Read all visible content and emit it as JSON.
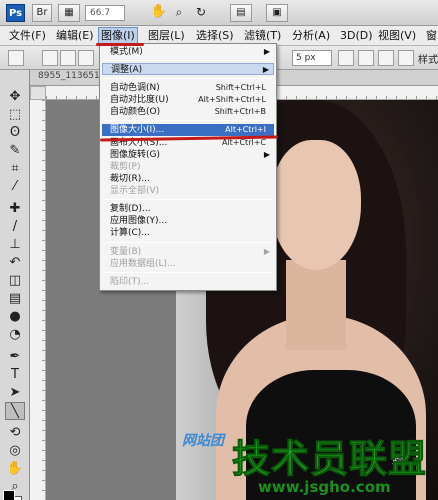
{
  "appbar": {
    "logo": "Ps",
    "zoom": "66.7"
  },
  "menubar": {
    "items": [
      "文件(F)",
      "编辑(E)",
      "图像(I)",
      "图层(L)",
      "选择(S)",
      "滤镜(T)",
      "分析(A)",
      "3D(D)",
      "视图(V)",
      "窗口"
    ]
  },
  "options": {
    "feather": "5 px",
    "style_label": "样式"
  },
  "document": {
    "tab_title": "8955_113651..."
  },
  "dropdown": {
    "items": [
      {
        "label": "模式(M)",
        "shortcut": "",
        "submenu": true,
        "disabled": false
      },
      {
        "label": "调整(A)",
        "shortcut": "",
        "submenu": true,
        "disabled": false
      },
      {
        "label": "自动色调(N)",
        "shortcut": "Shift+Ctrl+L",
        "submenu": false,
        "disabled": false
      },
      {
        "label": "自动对比度(U)",
        "shortcut": "Alt+Shift+Ctrl+L",
        "submenu": false,
        "disabled": false
      },
      {
        "label": "自动颜色(O)",
        "shortcut": "Shift+Ctrl+B",
        "submenu": false,
        "disabled": false
      },
      {
        "label": "图像大小(I)...",
        "shortcut": "Alt+Ctrl+I",
        "submenu": false,
        "disabled": false
      },
      {
        "label": "画布大小(S)...",
        "shortcut": "Alt+Ctrl+C",
        "submenu": false,
        "disabled": false
      },
      {
        "label": "图像旋转(G)",
        "shortcut": "",
        "submenu": true,
        "disabled": false
      },
      {
        "label": "裁剪(P)",
        "shortcut": "",
        "submenu": false,
        "disabled": true
      },
      {
        "label": "裁切(R)...",
        "shortcut": "",
        "submenu": false,
        "disabled": false
      },
      {
        "label": "显示全部(V)",
        "shortcut": "",
        "submenu": false,
        "disabled": true
      },
      {
        "label": "复制(D)...",
        "shortcut": "",
        "submenu": false,
        "disabled": false
      },
      {
        "label": "应用图像(Y)...",
        "shortcut": "",
        "submenu": false,
        "disabled": false
      },
      {
        "label": "计算(C)...",
        "shortcut": "",
        "submenu": false,
        "disabled": false
      },
      {
        "label": "变量(B)",
        "shortcut": "",
        "submenu": true,
        "disabled": true
      },
      {
        "label": "应用数据组(L)...",
        "shortcut": "",
        "submenu": false,
        "disabled": true
      },
      {
        "label": "陷印(T)...",
        "shortcut": "",
        "submenu": false,
        "disabled": true
      }
    ]
  },
  "watermark": {
    "brand": "技术员联盟",
    "url": "www.jsgho.com",
    "site_small": "网站团",
    "faint": "验"
  },
  "colors": {
    "highlight": "#3b6fc4",
    "annotation_red": "#c41a1a",
    "watermark_green": "#2db52d"
  }
}
